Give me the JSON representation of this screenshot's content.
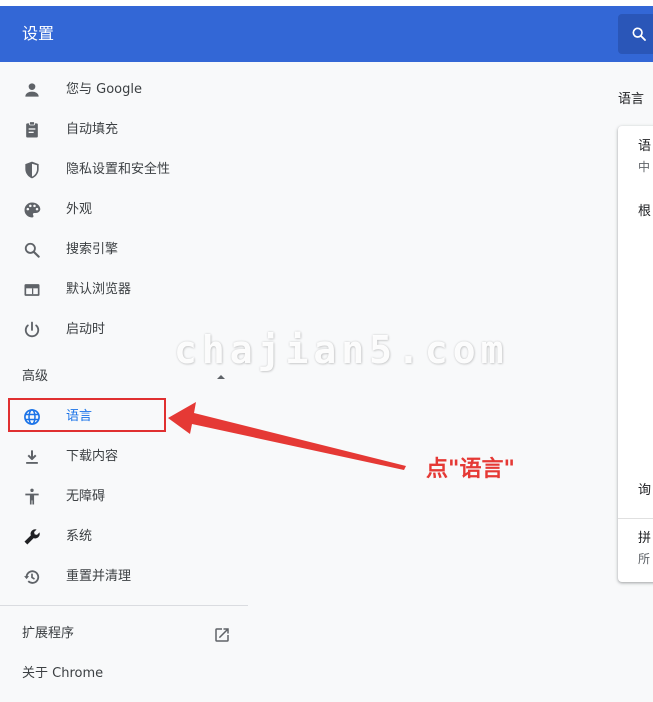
{
  "header": {
    "title": "设置",
    "search_icon": "search-icon"
  },
  "sidebar": {
    "items": [
      {
        "label": "您与 Google",
        "icon": "person-icon"
      },
      {
        "label": "自动填充",
        "icon": "clipboard-icon"
      },
      {
        "label": "隐私设置和安全性",
        "icon": "shield-icon"
      },
      {
        "label": "外观",
        "icon": "palette-icon"
      },
      {
        "label": "搜索引擎",
        "icon": "search-icon"
      },
      {
        "label": "默认浏览器",
        "icon": "browser-icon"
      },
      {
        "label": "启动时",
        "icon": "power-icon"
      }
    ],
    "advanced_title": "高级",
    "advanced_items": [
      {
        "label": "语言",
        "icon": "globe-icon",
        "selected": true
      },
      {
        "label": "下载内容",
        "icon": "download-icon"
      },
      {
        "label": "无障碍",
        "icon": "accessibility-icon"
      },
      {
        "label": "系统",
        "icon": "wrench-icon"
      },
      {
        "label": "重置并清理",
        "icon": "restore-icon"
      }
    ],
    "extensions_label": "扩展程序",
    "about_label": "关于 Chrome"
  },
  "main": {
    "section_label": "语言",
    "card": {
      "row1_title": "语",
      "row1_sub": "中",
      "row2_title": "根",
      "row3_title": "询",
      "row4_title": "拼",
      "row4_sub": "所"
    }
  },
  "overlay": {
    "watermark": "chajian5.com",
    "annotation": "点\"语言\"",
    "annotation_color": "#e53935"
  },
  "colors": {
    "header": "#3367d6",
    "accent": "#1a73e8"
  }
}
